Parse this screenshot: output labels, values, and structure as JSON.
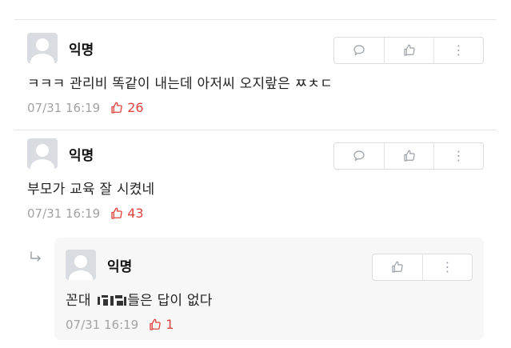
{
  "comments": [
    {
      "author": "익명",
      "text": "ㅋㅋㅋ 관리비 똑같이 내는데 아저씨 오지랖은 ㅉㅊㄷ",
      "time": "07/31 16:19",
      "likes": "26"
    },
    {
      "author": "익명",
      "text": "부모가 교육 잘 시켰네",
      "time": "07/31 16:19",
      "likes": "43"
    }
  ],
  "reply": {
    "author": "익명",
    "text_before": "꼰대 ",
    "text_after": "들은 답이 없다",
    "time": "07/31 16:19",
    "likes": "1"
  },
  "icons": {
    "comment": "speech-bubble-icon",
    "like": "thumbs-up-icon",
    "more": "more-vertical-icon",
    "reply": "reply-arrow-icon"
  },
  "colors": {
    "like_accent": "#e0443f",
    "meta_gray": "#a3a3a3",
    "reply_bg": "#f7f7f8"
  }
}
